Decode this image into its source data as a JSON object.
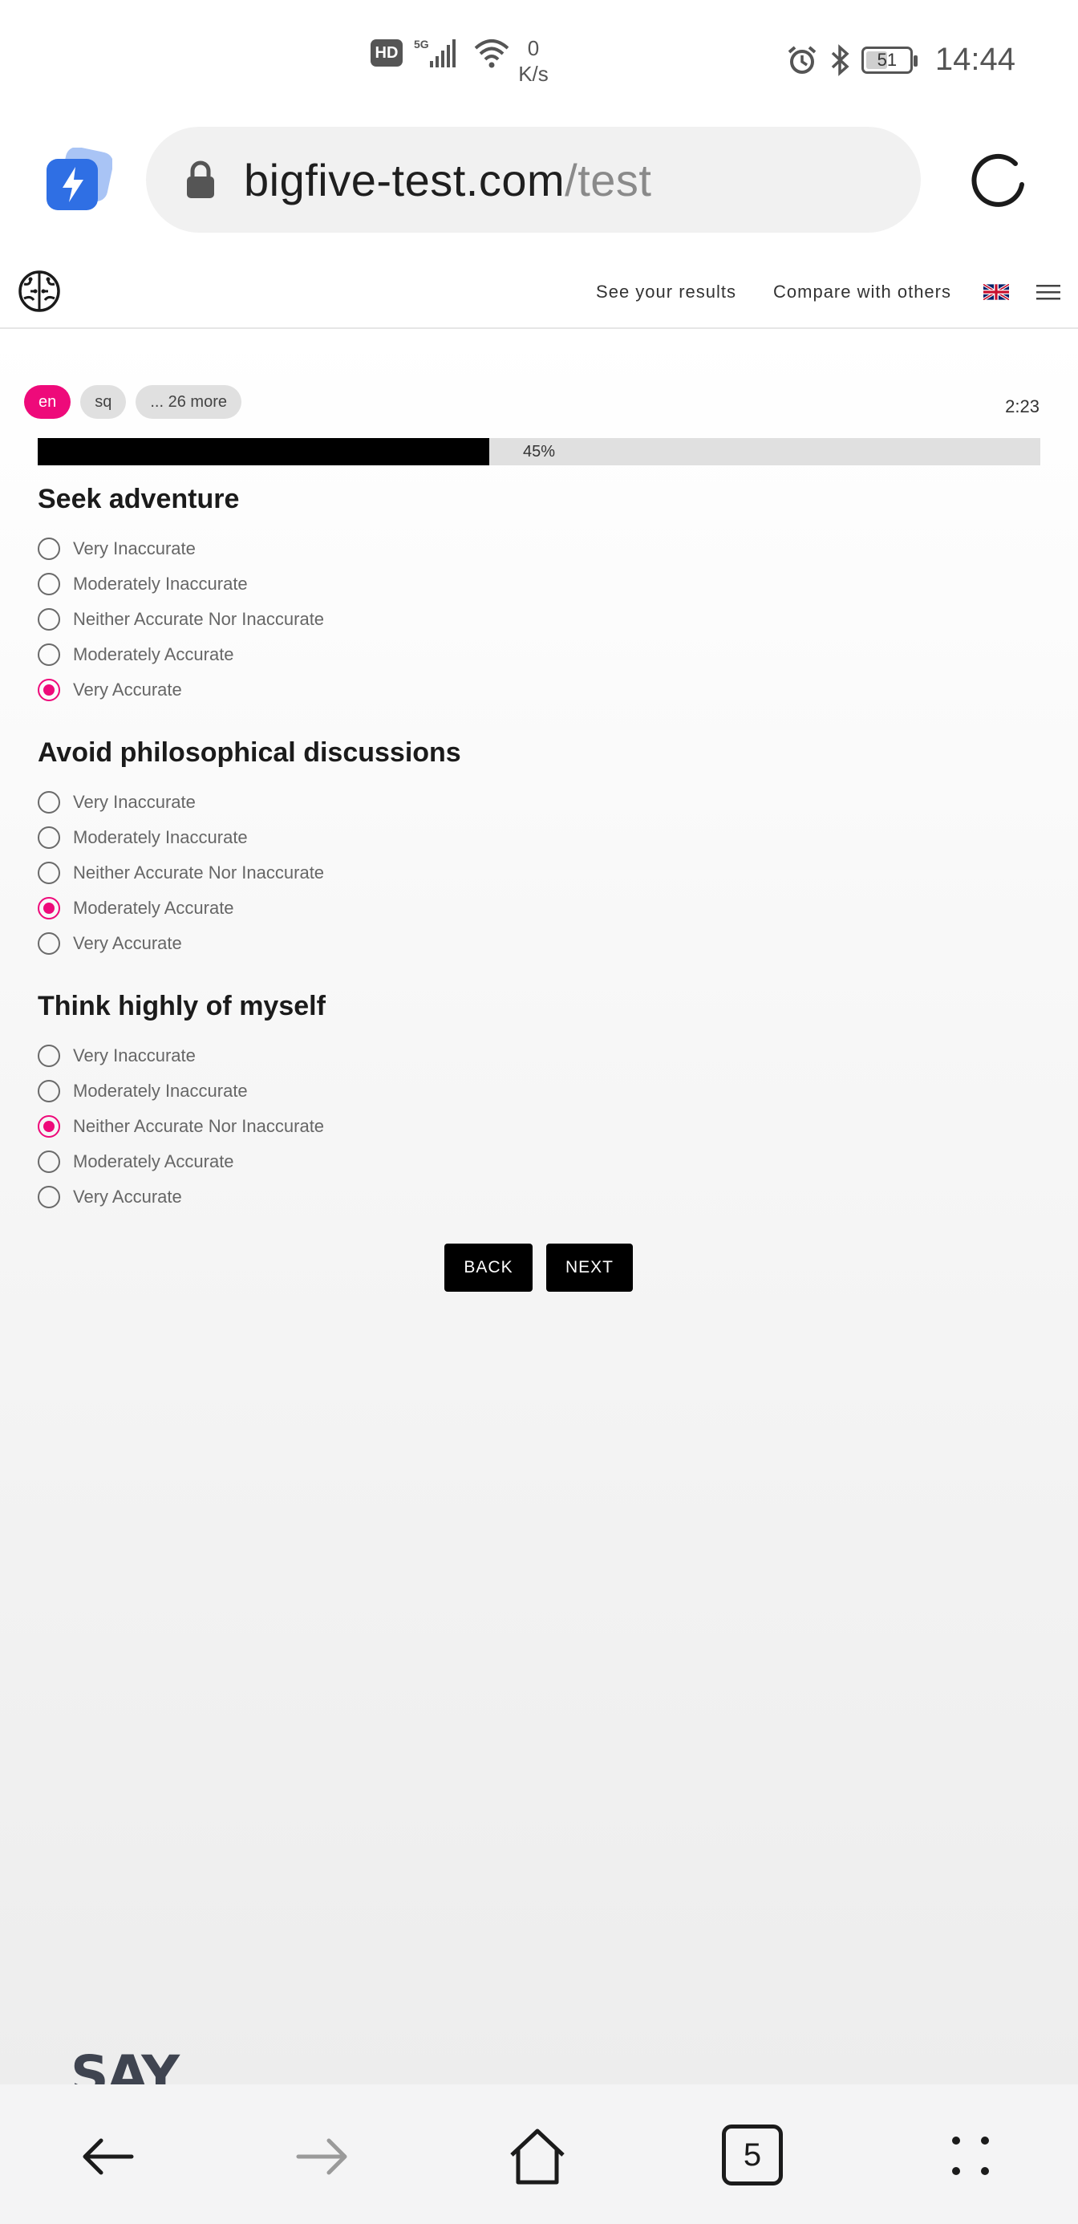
{
  "status_bar": {
    "hd_label": "HD",
    "network_type": "5G",
    "speed_value": "0",
    "speed_unit": "K/s",
    "battery": "51",
    "time": "14:44"
  },
  "browser": {
    "url_domain": "bigfive-test.com",
    "url_path": "/test",
    "tab_count": "5"
  },
  "site_nav": {
    "see_results": "See your results",
    "compare": "Compare with others"
  },
  "languages": [
    {
      "label": "en",
      "active": true
    },
    {
      "label": "sq",
      "active": false
    },
    {
      "label": "... 26 more",
      "active": false
    }
  ],
  "timer": "2:23",
  "progress": {
    "label": "45%",
    "value": 45
  },
  "questions": [
    {
      "title": "Seek adventure",
      "options": [
        "Very Inaccurate",
        "Moderately Inaccurate",
        "Neither Accurate Nor Inaccurate",
        "Moderately Accurate",
        "Very Accurate"
      ],
      "selected": 4
    },
    {
      "title": "Avoid philosophical discussions",
      "options": [
        "Very Inaccurate",
        "Moderately Inaccurate",
        "Neither Accurate Nor Inaccurate",
        "Moderately Accurate",
        "Very Accurate"
      ],
      "selected": 3
    },
    {
      "title": "Think highly of myself",
      "options": [
        "Very Inaccurate",
        "Moderately Inaccurate",
        "Neither Accurate Nor Inaccurate",
        "Moderately Accurate",
        "Very Accurate"
      ],
      "selected": 2
    }
  ],
  "buttons": {
    "back": "BACK",
    "next": "NEXT"
  },
  "ad_text": "SAY",
  "colors": {
    "accent": "#ee0a7a",
    "progress": "#000000"
  }
}
